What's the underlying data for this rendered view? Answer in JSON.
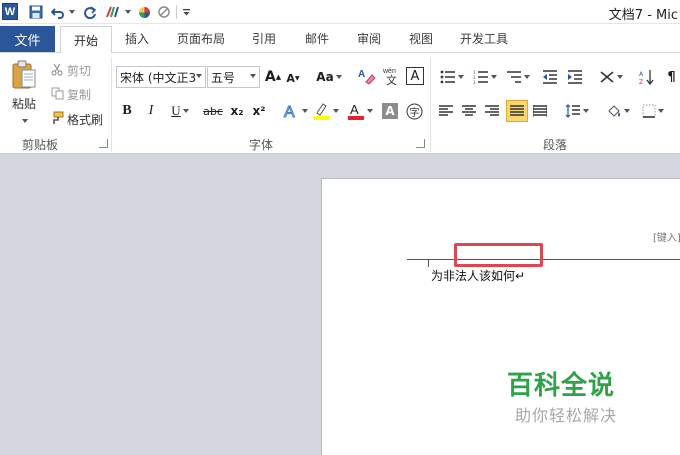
{
  "window": {
    "title": "文档7 - Mic"
  },
  "qat": {
    "logo_letter": "W"
  },
  "tabs": {
    "file": "文件",
    "items": [
      "开始",
      "插入",
      "页面布局",
      "引用",
      "邮件",
      "审阅",
      "视图",
      "开发工具"
    ]
  },
  "clipboard": {
    "paste": "粘贴",
    "cut": "剪切",
    "copy": "复制",
    "format_painter": "格式刷",
    "group_label": "剪贴板"
  },
  "font": {
    "font_name": "宋体 (中文正3",
    "font_size": "五号",
    "group_label": "字体",
    "bold": "B",
    "italic": "I",
    "underline": "U",
    "strike": "abc",
    "subscript": "x₂",
    "superscript": "x²",
    "grow": "A",
    "shrink": "A",
    "change_case": "Aa",
    "highlight_color": "#ffff00",
    "font_color": "#e3242b"
  },
  "paragraph": {
    "group_label": "段落"
  },
  "document": {
    "header_hint": "[键入]",
    "body_text": "为非法人该如何↵"
  },
  "watermark": {
    "title": "百科全说",
    "subtitle": "助你轻松解决",
    "title_color": "#2fa24a"
  }
}
